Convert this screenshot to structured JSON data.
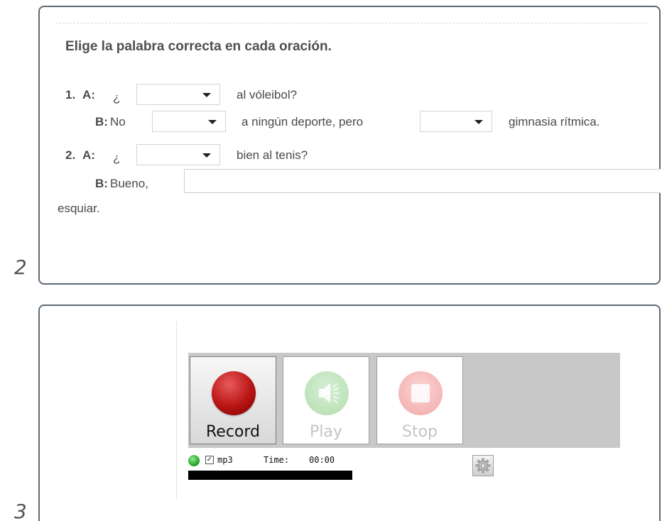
{
  "exercise2": {
    "number": "2",
    "instruction": "Elige la palabra correcta en cada oración.",
    "items": [
      {
        "num": "1.",
        "a_label": "A:",
        "a_prefix": "¿",
        "a_suffix": "al vóleibol?",
        "b_label": "B:",
        "b_prefix": "No",
        "b_middle": "a ningún deporte, pero",
        "b_suffix": "gimnasia rítmica."
      },
      {
        "num": "2.",
        "a_label": "A:",
        "a_prefix": "¿",
        "a_suffix": "bien al tenis?",
        "b_label": "B:",
        "b_prefix": "Bueno,",
        "b_wrap": "esquiar.",
        "b_input_value": ""
      }
    ]
  },
  "exercise3": {
    "number": "3",
    "recorder": {
      "record_label": "Record",
      "play_label": "Play",
      "stop_label": "Stop",
      "format_label": "mp3",
      "format_checked": true,
      "time_label": "Time:",
      "time_value": "00:00",
      "status_color": "#2da82d",
      "progress": 0
    }
  }
}
